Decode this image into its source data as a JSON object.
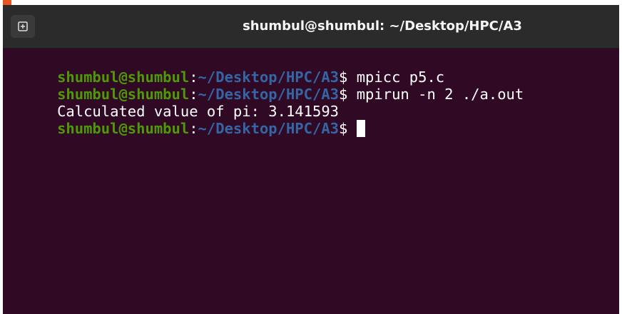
{
  "window": {
    "title": "shumbul@shumbul: ~/Desktop/HPC/A3",
    "new_tab_icon": "terminal-new-tab-icon"
  },
  "terminal": {
    "lines": [
      {
        "type": "prompt",
        "user_host": "shumbul@shumbul",
        "colon": ":",
        "path": "~/Desktop/HPC/A3",
        "dollar": "$ ",
        "command": "mpicc p5.c"
      },
      {
        "type": "prompt",
        "user_host": "shumbul@shumbul",
        "colon": ":",
        "path": "~/Desktop/HPC/A3",
        "dollar": "$ ",
        "command": "mpirun -n 2 ./a.out"
      },
      {
        "type": "output",
        "text": "Calculated value of pi: 3.141593"
      },
      {
        "type": "prompt",
        "user_host": "shumbul@shumbul",
        "colon": ":",
        "path": "~/Desktop/HPC/A3",
        "dollar": "$ ",
        "command": ""
      }
    ]
  },
  "colors": {
    "background": "#300a24",
    "titlebar": "#2b2b2b",
    "user_host": "#4e9a06",
    "path": "#3465a4",
    "text": "#ffffff"
  }
}
